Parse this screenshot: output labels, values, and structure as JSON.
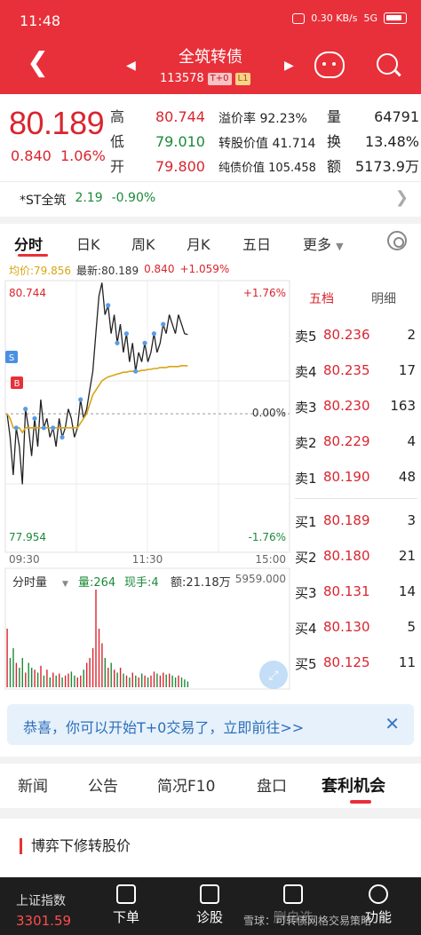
{
  "status_bar": {
    "time": "11:48",
    "net_speed": "0.30 KB/s",
    "signal": "5G"
  },
  "header": {
    "title": "全筑转债",
    "code": "113578",
    "tag1": "T+0",
    "tag2": "L1",
    "icons": [
      "chevron-left-icon",
      "triangle-left-icon",
      "triangle-right-icon",
      "mascot-icon",
      "search-icon"
    ]
  },
  "quote": {
    "price": "80.189",
    "change": "0.840",
    "change_pct": "1.06%",
    "high_label": "高",
    "high": "80.744",
    "low_label": "低",
    "low": "79.010",
    "open_label": "开",
    "open": "79.800",
    "premium_label": "溢价率",
    "premium": "92.23%",
    "conv_value_label": "转股价值",
    "conv_value": "41.714",
    "bond_value_label": "纯债价值",
    "bond_value": "105.458",
    "volume_label": "量",
    "volume": "64791",
    "turnover_label": "换",
    "turnover": "13.48%",
    "amount_label": "额",
    "amount": "5173.9万"
  },
  "related": {
    "name": "*ST全筑",
    "price": "2.19",
    "change_pct": "-0.90%"
  },
  "tabs": [
    "分时",
    "日K",
    "周K",
    "月K",
    "五日",
    "更多"
  ],
  "avg_row": {
    "avg": "均价:79.856",
    "latest": "最新:80.189",
    "chg": "0.840",
    "pct": "+1.059%"
  },
  "chart_data": {
    "type": "line",
    "title": "",
    "y_top_label": "80.744",
    "y_bottom_label": "77.954",
    "pct_top": "+1.76%",
    "pct_mid": "0.00%",
    "pct_bottom": "-1.76%",
    "x_labels": [
      "09:30",
      "11:30",
      "15:00"
    ],
    "ylim": [
      77.954,
      80.744
    ],
    "prev_close": 79.349,
    "series": [
      {
        "values": [
          79.35,
          79.1,
          78.7,
          79.2,
          79.0,
          78.6,
          79.4,
          79.2,
          78.9,
          79.3,
          79.0,
          79.5,
          79.2,
          79.3,
          79.1,
          79.2,
          79.0,
          79.3,
          79.1,
          79.2,
          79.4,
          79.3,
          79.1,
          79.2,
          79.5,
          79.3,
          79.4,
          79.6,
          79.8,
          80.2,
          80.6,
          80.74,
          80.4,
          80.5,
          80.2,
          80.4,
          80.1,
          80.3,
          80.0,
          80.2,
          79.9,
          80.1,
          79.8,
          80.0,
          79.9,
          80.1,
          79.9,
          80.0,
          80.2,
          80.0,
          80.1,
          80.3,
          80.2,
          80.4,
          80.3,
          80.2,
          80.4,
          80.3,
          80.2,
          80.19
        ]
      },
      {
        "values": [
          79.35,
          79.3,
          79.2,
          79.2,
          79.2,
          79.15,
          79.2,
          79.2,
          79.2,
          79.2,
          79.2,
          79.2,
          79.2,
          79.2,
          79.2,
          79.2,
          79.2,
          79.2,
          79.2,
          79.2,
          79.2,
          79.2,
          79.2,
          79.2,
          79.25,
          79.3,
          79.35,
          79.45,
          79.55,
          79.6,
          79.65,
          79.7,
          79.72,
          79.74,
          79.75,
          79.76,
          79.77,
          79.78,
          79.79,
          79.79,
          79.8,
          79.8,
          79.8,
          79.8,
          79.81,
          79.81,
          79.82,
          79.82,
          79.83,
          79.83,
          79.84,
          79.84,
          79.84,
          79.85,
          79.85,
          79.85,
          79.85,
          79.86,
          79.86,
          79.856
        ]
      }
    ],
    "volume_label": "分时量",
    "volume_max_label": "5959.000",
    "vol_now": "量:264",
    "hand_now": "现手:4",
    "amount_now": "额:21.18万",
    "volumes": [
      60,
      30,
      40,
      25,
      20,
      30,
      15,
      25,
      20,
      18,
      15,
      22,
      12,
      18,
      10,
      15,
      12,
      14,
      10,
      12,
      14,
      16,
      12,
      10,
      12,
      18,
      25,
      30,
      40,
      100,
      60,
      45,
      30,
      20,
      25,
      18,
      15,
      20,
      14,
      12,
      10,
      15,
      12,
      10,
      14,
      12,
      10,
      12,
      16,
      14,
      12,
      15,
      13,
      14,
      12,
      10,
      12,
      10,
      8,
      6
    ],
    "markers": [
      "S",
      "B"
    ]
  },
  "order_book": {
    "tabs": [
      "五档",
      "明细"
    ],
    "sell": [
      {
        "label": "卖5",
        "price": "80.236",
        "vol": "2"
      },
      {
        "label": "卖4",
        "price": "80.235",
        "vol": "17"
      },
      {
        "label": "卖3",
        "price": "80.230",
        "vol": "163"
      },
      {
        "label": "卖2",
        "price": "80.229",
        "vol": "4"
      },
      {
        "label": "卖1",
        "price": "80.190",
        "vol": "48"
      }
    ],
    "buy": [
      {
        "label": "买1",
        "price": "80.189",
        "vol": "3"
      },
      {
        "label": "买2",
        "price": "80.180",
        "vol": "21"
      },
      {
        "label": "买3",
        "price": "80.131",
        "vol": "14"
      },
      {
        "label": "买4",
        "price": "80.130",
        "vol": "5"
      },
      {
        "label": "买5",
        "price": "80.125",
        "vol": "11"
      }
    ]
  },
  "banner": {
    "text": "恭喜，你可以开始T+0交易了，立即前往>>"
  },
  "bottom_tabs": [
    "新闻",
    "公告",
    "简况F10",
    "盘口",
    "套利机会"
  ],
  "section": {
    "title": "博弈下修转股价"
  },
  "toolbar": {
    "index_label": "上证指数",
    "index_value": "3301.59",
    "items": [
      "下单",
      "诊股",
      "删自选",
      "功能"
    ],
    "watermark": "雪球：可转债网格交易策略"
  },
  "colors": {
    "brand": "#e8303a",
    "up": "#d9252f",
    "down": "#1b8a3a",
    "avg_line": "#d9a514",
    "price_line": "#222222"
  }
}
